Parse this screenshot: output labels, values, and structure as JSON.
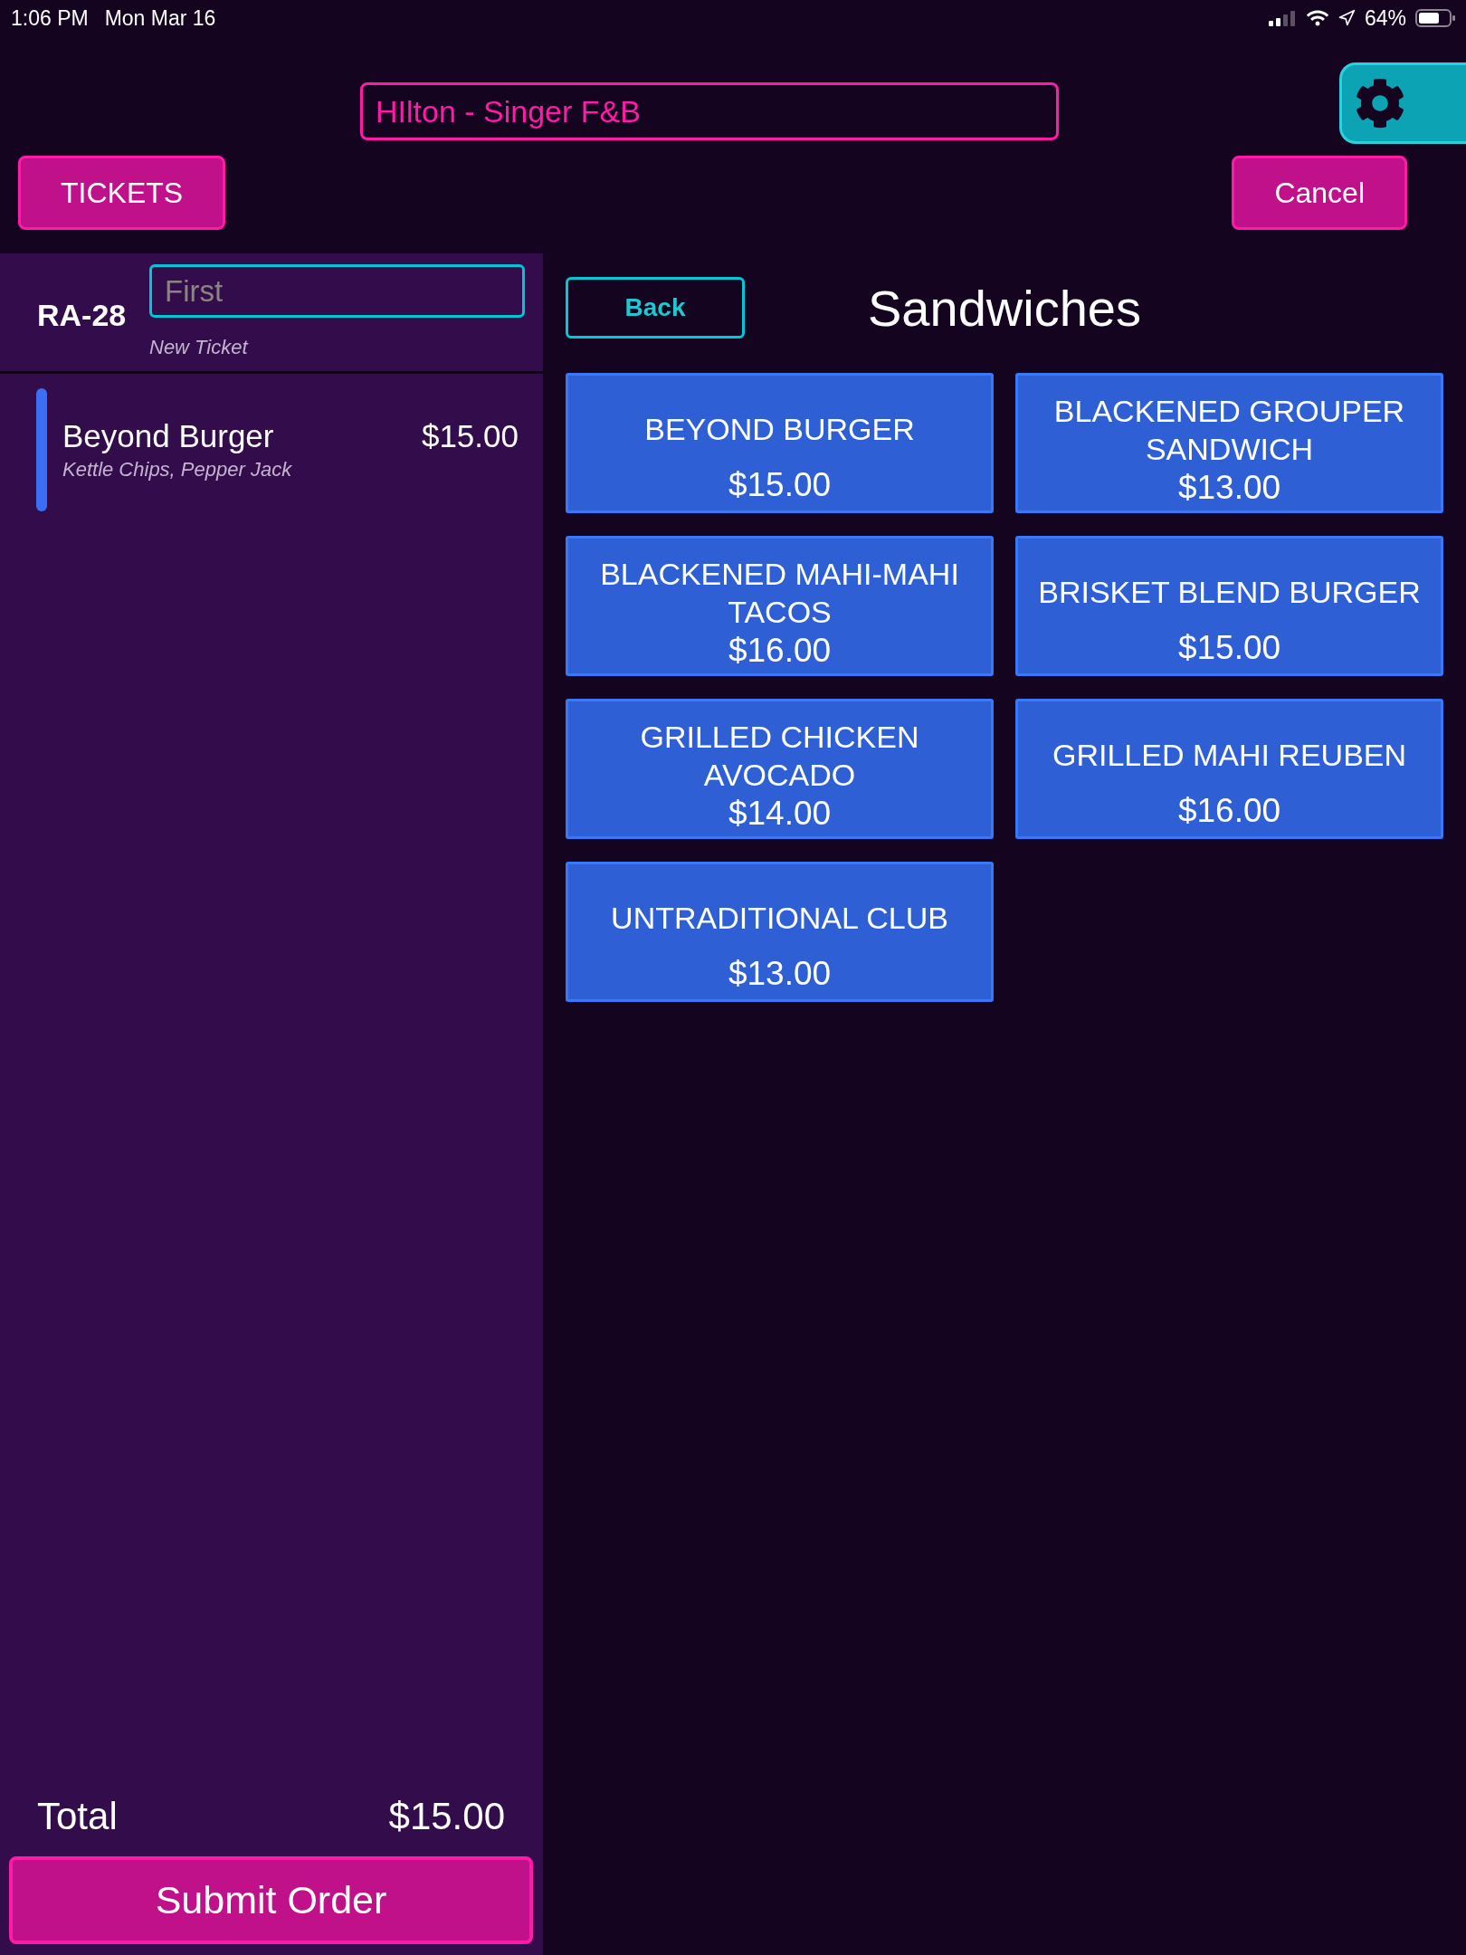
{
  "status_bar": {
    "time": "1:06 PM",
    "date": "Mon Mar 16",
    "battery_percent": "64%"
  },
  "header": {
    "venue_field": {
      "value": "HIlton - Singer F&B"
    },
    "tickets_button": "TICKETS",
    "cancel_button": "Cancel"
  },
  "ticket": {
    "number": "RA-28",
    "name_field": {
      "placeholder": "First"
    },
    "status": "New Ticket",
    "items": [
      {
        "name": "Beyond Burger",
        "price": "$15.00",
        "modifiers": "Kettle Chips, Pepper Jack"
      }
    ],
    "total_label": "Total",
    "total": "$15.00",
    "submit_button": "Submit Order"
  },
  "menu": {
    "back_button": "Back",
    "title": "Sandwiches",
    "items": [
      {
        "name": "BEYOND BURGER",
        "price": "$15.00"
      },
      {
        "name": "BLACKENED GROUPER SANDWICH",
        "price": "$13.00"
      },
      {
        "name": "BLACKENED MAHI-MAHI TACOS",
        "price": "$16.00"
      },
      {
        "name": "BRISKET BLEND BURGER",
        "price": "$15.00"
      },
      {
        "name": "GRILLED CHICKEN AVOCADO",
        "price": "$14.00"
      },
      {
        "name": "GRILLED MAHI REUBEN",
        "price": "$16.00"
      },
      {
        "name": "UNTRADITIONAL CLUB",
        "price": "$13.00"
      }
    ]
  }
}
